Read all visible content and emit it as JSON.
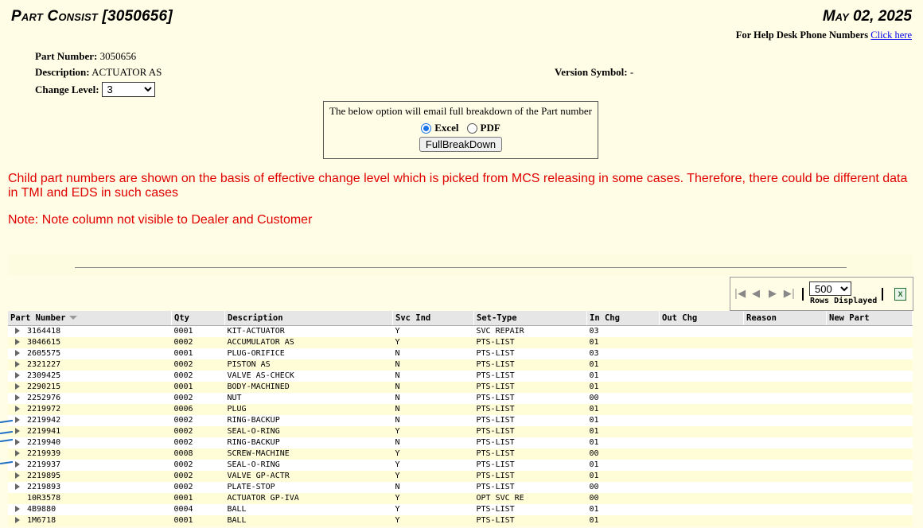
{
  "header": {
    "title": "Part Consist [3050656]",
    "date": "May 02, 2025",
    "help_prefix": "For Help Desk Phone Numbers",
    "help_link": "Click here"
  },
  "part": {
    "number_label": "Part Number:",
    "number_value": "3050656",
    "description_label": "Description:",
    "description_value": "ACTUATOR AS",
    "version_label": "Version Symbol:",
    "version_value": "-",
    "change_label": "Change Level:",
    "change_value": "3"
  },
  "email_box": {
    "message": "The below option will email full breakdown of the Part number",
    "option_excel": "Excel",
    "option_pdf": "PDF",
    "selected": "Excel",
    "button": "FullBreakDown"
  },
  "notices": {
    "line1": "Child part numbers are shown on the basis of effective change level which is picked from MCS releasing in some cases. Therefore, there could be different data",
    "line2": "in TMI and EDS in such cases",
    "note": "Note: Note column not visible to Dealer and Customer"
  },
  "toolbar": {
    "rows_value": "500",
    "rows_label": "Rows Displayed"
  },
  "table": {
    "columns": [
      "Part Number",
      "Qty",
      "Description",
      "Svc Ind",
      "Set-Type",
      "In Chg",
      "Out Chg",
      "Reason",
      "New Part"
    ],
    "rows": [
      {
        "part": "3164418",
        "qty": "0001",
        "desc": "KIT-ACTUATOR",
        "svc": "Y",
        "set": "SVC REPAIR",
        "in": "03",
        "expand": true
      },
      {
        "part": "3046615",
        "qty": "0002",
        "desc": "ACCUMULATOR AS",
        "svc": "Y",
        "set": "PTS-LIST",
        "in": "01",
        "expand": true
      },
      {
        "part": "2605575",
        "qty": "0001",
        "desc": "PLUG-ORIFICE",
        "svc": "N",
        "set": "PTS-LIST",
        "in": "03",
        "expand": true
      },
      {
        "part": "2321227",
        "qty": "0002",
        "desc": "PISTON AS",
        "svc": "N",
        "set": "PTS-LIST",
        "in": "01",
        "expand": true
      },
      {
        "part": "2309425",
        "qty": "0002",
        "desc": "VALVE AS-CHECK",
        "svc": "N",
        "set": "PTS-LIST",
        "in": "01",
        "expand": true
      },
      {
        "part": "2290215",
        "qty": "0001",
        "desc": "BODY-MACHINED",
        "svc": "N",
        "set": "PTS-LIST",
        "in": "01",
        "expand": true
      },
      {
        "part": "2252976",
        "qty": "0002",
        "desc": "NUT",
        "svc": "N",
        "set": "PTS-LIST",
        "in": "00",
        "expand": true
      },
      {
        "part": "2219972",
        "qty": "0006",
        "desc": "PLUG",
        "svc": "N",
        "set": "PTS-LIST",
        "in": "01",
        "expand": true
      },
      {
        "part": "2219942",
        "qty": "0002",
        "desc": "RING-BACKUP",
        "svc": "N",
        "set": "PTS-LIST",
        "in": "01",
        "expand": true
      },
      {
        "part": "2219941",
        "qty": "0002",
        "desc": "SEAL-O-RING",
        "svc": "Y",
        "set": "PTS-LIST",
        "in": "01",
        "expand": true
      },
      {
        "part": "2219940",
        "qty": "0002",
        "desc": "RING-BACKUP",
        "svc": "N",
        "set": "PTS-LIST",
        "in": "01",
        "expand": true
      },
      {
        "part": "2219939",
        "qty": "0008",
        "desc": "SCREW-MACHINE",
        "svc": "Y",
        "set": "PTS-LIST",
        "in": "00",
        "expand": true
      },
      {
        "part": "2219937",
        "qty": "0002",
        "desc": "SEAL-O-RING",
        "svc": "Y",
        "set": "PTS-LIST",
        "in": "01",
        "expand": true
      },
      {
        "part": "2219895",
        "qty": "0002",
        "desc": "VALVE GP-ACTR",
        "svc": "Y",
        "set": "PTS-LIST",
        "in": "01",
        "expand": true
      },
      {
        "part": "2219893",
        "qty": "0002",
        "desc": "PLATE-STOP",
        "svc": "N",
        "set": "PTS-LIST",
        "in": "00",
        "expand": true
      },
      {
        "part": "10R3578",
        "qty": "0001",
        "desc": "ACTUATOR GP-IVA",
        "svc": "Y",
        "set": "OPT SVC RE",
        "in": "00",
        "expand": false
      },
      {
        "part": "4B9880",
        "qty": "0004",
        "desc": "BALL",
        "svc": "Y",
        "set": "PTS-LIST",
        "in": "01",
        "expand": true
      },
      {
        "part": "1M6718",
        "qty": "0001",
        "desc": "BALL",
        "svc": "Y",
        "set": "PTS-LIST",
        "in": "01",
        "expand": true
      }
    ]
  },
  "colors": {
    "background": "#fffde6",
    "notice_red": "#e00000",
    "alt_row": "#fffcd8",
    "header_gray": "#e6e6e6",
    "marker_blue": "#1f6fc5"
  }
}
